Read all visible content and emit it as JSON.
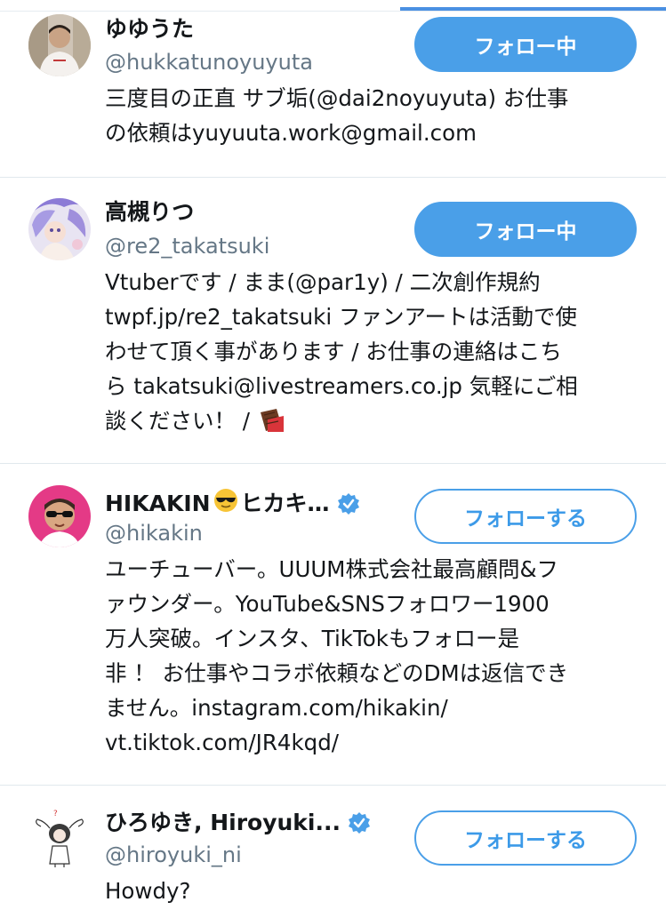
{
  "accent_color": "#4a9fe8",
  "users": [
    {
      "display_name": "ゆゆうた",
      "screen_name": "@hukkatunoyuyuta",
      "bio": "三度目の正直 サブ垢(@dai2noyuyuta) お仕事\nの依頼はyuyuuta.work@gmail.com",
      "follow_label": "フォロー中",
      "following": true,
      "verified": false,
      "avatar": "avatar-person-photo"
    },
    {
      "display_name": "高槻りつ",
      "screen_name": "@re2_takatsuki",
      "bio": "Vtuberです / まま(@par1y) / 二次創作規約\ntwpf.jp/re2_takatsuki ファンアートは活動で使\nわせて頂く事があります / お仕事の連絡はこち\nら takatsuki@livestreamers.co.jp 気軽にご相\n談ください！ /",
      "bio_emoji": "chocolate-bar-icon",
      "follow_label": "フォロー中",
      "following": true,
      "verified": false,
      "avatar": "avatar-anime-illustration"
    },
    {
      "display_name": "HIKAKIN",
      "display_name_suffix": "ヒカキ…",
      "display_name_emoji": "sunglasses-face-icon",
      "screen_name": "@hikakin",
      "bio": "ユーチューバー。UUUM株式会社最高顧問&フ\nァウンダー。YouTube&SNSフォロワー1900\n万人突破。インスタ、TikTokもフォロー是\n非 ！ お仕事やコラボ依頼などのDMは返信でき\nません。instagram.com/hikakin/\nvt.tiktok.com/JR4kqd/",
      "follow_label": "フォローする",
      "following": false,
      "verified": true,
      "avatar": "avatar-sunglasses-photo"
    },
    {
      "display_name": "ひろゆき, Hiroyuki...",
      "screen_name": "@hiroyuki_ni",
      "bio": "Howdy?",
      "follow_label": "フォローする",
      "following": false,
      "verified": true,
      "avatar": "avatar-bunny-drawing"
    }
  ]
}
